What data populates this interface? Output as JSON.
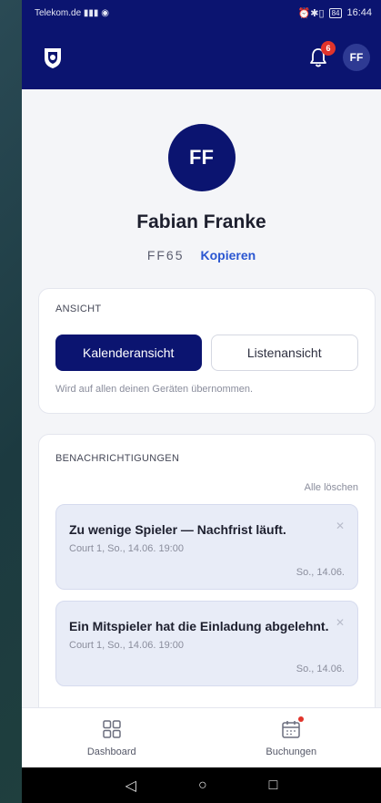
{
  "status_bar": {
    "carrier": "Telekom.de",
    "time": "16:44",
    "battery": "84"
  },
  "header": {
    "logo_icon": "club-crest-icon",
    "notification_count": "6",
    "avatar_initials": "FF",
    "bar_color": "#0b1470"
  },
  "profile": {
    "initials": "FF",
    "name": "Fabian Franke",
    "code": "FF65",
    "copy_label": "Kopieren"
  },
  "view_section": {
    "title": "ANSICHT",
    "calendar_label": "Kalenderansicht",
    "list_label": "Listenansicht",
    "selected": "Kalenderansicht",
    "hint": "Wird auf allen deinen Geräten übernommen."
  },
  "notifications_section": {
    "title": "BENACHRICHTIGUNGEN",
    "clear_all_label": "Alle löschen",
    "items": [
      {
        "title": "Zu wenige Spieler — Nachfrist läuft.",
        "subtitle": "Court 1, So., 14.06. 19:00",
        "date": "So., 14.06."
      },
      {
        "title": "Ein Mitspieler hat die Einladung abgelehnt.",
        "subtitle": "Court 1, So., 14.06. 19:00",
        "date": "So., 14.06."
      }
    ]
  },
  "bottom_nav": {
    "dashboard_label": "Dashboard",
    "bookings_label": "Buchungen"
  },
  "accent_colors": {
    "primary": "#0b1470",
    "link": "#2a56d1",
    "badge": "#e1342b"
  }
}
